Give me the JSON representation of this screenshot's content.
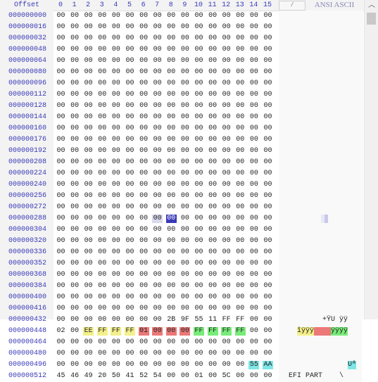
{
  "header": {
    "offset_label": "Offset",
    "columns": [
      "0",
      "1",
      "2",
      "3",
      "4",
      "5",
      "6",
      "7",
      "8",
      "9",
      "10",
      "11",
      "12",
      "13",
      "14",
      "15"
    ],
    "corner_label": "/",
    "ascii_label": "ANSI ASCII"
  },
  "rows": [
    {
      "offset": "000000000",
      "bytes": [
        "00",
        "00",
        "00",
        "00",
        "00",
        "00",
        "00",
        "00",
        "00",
        "00",
        "00",
        "00",
        "00",
        "00",
        "00",
        "00"
      ],
      "ascii": ""
    },
    {
      "offset": "000000016",
      "bytes": [
        "00",
        "00",
        "00",
        "00",
        "00",
        "00",
        "00",
        "00",
        "00",
        "00",
        "00",
        "00",
        "00",
        "00",
        "00",
        "00"
      ],
      "ascii": ""
    },
    {
      "offset": "000000032",
      "bytes": [
        "00",
        "00",
        "00",
        "00",
        "00",
        "00",
        "00",
        "00",
        "00",
        "00",
        "00",
        "00",
        "00",
        "00",
        "00",
        "00"
      ],
      "ascii": ""
    },
    {
      "offset": "000000048",
      "bytes": [
        "00",
        "00",
        "00",
        "00",
        "00",
        "00",
        "00",
        "00",
        "00",
        "00",
        "00",
        "00",
        "00",
        "00",
        "00",
        "00"
      ],
      "ascii": ""
    },
    {
      "offset": "000000064",
      "bytes": [
        "00",
        "00",
        "00",
        "00",
        "00",
        "00",
        "00",
        "00",
        "00",
        "00",
        "00",
        "00",
        "00",
        "00",
        "00",
        "00"
      ],
      "ascii": ""
    },
    {
      "offset": "000000080",
      "bytes": [
        "00",
        "00",
        "00",
        "00",
        "00",
        "00",
        "00",
        "00",
        "00",
        "00",
        "00",
        "00",
        "00",
        "00",
        "00",
        "00"
      ],
      "ascii": ""
    },
    {
      "offset": "000000096",
      "bytes": [
        "00",
        "00",
        "00",
        "00",
        "00",
        "00",
        "00",
        "00",
        "00",
        "00",
        "00",
        "00",
        "00",
        "00",
        "00",
        "00"
      ],
      "ascii": ""
    },
    {
      "offset": "000000112",
      "bytes": [
        "00",
        "00",
        "00",
        "00",
        "00",
        "00",
        "00",
        "00",
        "00",
        "00",
        "00",
        "00",
        "00",
        "00",
        "00",
        "00"
      ],
      "ascii": ""
    },
    {
      "offset": "000000128",
      "bytes": [
        "00",
        "00",
        "00",
        "00",
        "00",
        "00",
        "00",
        "00",
        "00",
        "00",
        "00",
        "00",
        "00",
        "00",
        "00",
        "00"
      ],
      "ascii": ""
    },
    {
      "offset": "000000144",
      "bytes": [
        "00",
        "00",
        "00",
        "00",
        "00",
        "00",
        "00",
        "00",
        "00",
        "00",
        "00",
        "00",
        "00",
        "00",
        "00",
        "00"
      ],
      "ascii": ""
    },
    {
      "offset": "000000160",
      "bytes": [
        "00",
        "00",
        "00",
        "00",
        "00",
        "00",
        "00",
        "00",
        "00",
        "00",
        "00",
        "00",
        "00",
        "00",
        "00",
        "00"
      ],
      "ascii": ""
    },
    {
      "offset": "000000176",
      "bytes": [
        "00",
        "00",
        "00",
        "00",
        "00",
        "00",
        "00",
        "00",
        "00",
        "00",
        "00",
        "00",
        "00",
        "00",
        "00",
        "00"
      ],
      "ascii": ""
    },
    {
      "offset": "000000192",
      "bytes": [
        "00",
        "00",
        "00",
        "00",
        "00",
        "00",
        "00",
        "00",
        "00",
        "00",
        "00",
        "00",
        "00",
        "00",
        "00",
        "00"
      ],
      "ascii": ""
    },
    {
      "offset": "000000208",
      "bytes": [
        "00",
        "00",
        "00",
        "00",
        "00",
        "00",
        "00",
        "00",
        "00",
        "00",
        "00",
        "00",
        "00",
        "00",
        "00",
        "00"
      ],
      "ascii": ""
    },
    {
      "offset": "000000224",
      "bytes": [
        "00",
        "00",
        "00",
        "00",
        "00",
        "00",
        "00",
        "00",
        "00",
        "00",
        "00",
        "00",
        "00",
        "00",
        "00",
        "00"
      ],
      "ascii": ""
    },
    {
      "offset": "000000240",
      "bytes": [
        "00",
        "00",
        "00",
        "00",
        "00",
        "00",
        "00",
        "00",
        "00",
        "00",
        "00",
        "00",
        "00",
        "00",
        "00",
        "00"
      ],
      "ascii": ""
    },
    {
      "offset": "000000256",
      "bytes": [
        "00",
        "00",
        "00",
        "00",
        "00",
        "00",
        "00",
        "00",
        "00",
        "00",
        "00",
        "00",
        "00",
        "00",
        "00",
        "00"
      ],
      "ascii": ""
    },
    {
      "offset": "000000272",
      "bytes": [
        "00",
        "00",
        "00",
        "00",
        "00",
        "00",
        "00",
        "00",
        "00",
        "00",
        "00",
        "00",
        "00",
        "00",
        "00",
        "00"
      ],
      "ascii": ""
    },
    {
      "offset": "000000288",
      "bytes": [
        "00",
        "00",
        "00",
        "00",
        "00",
        "00",
        "00",
        "00",
        "00",
        "00",
        "00",
        "00",
        "00",
        "00",
        "00",
        "00"
      ],
      "ascii": "",
      "marks": {
        "7": "s",
        "8": "caret"
      }
    },
    {
      "offset": "000000304",
      "bytes": [
        "00",
        "00",
        "00",
        "00",
        "00",
        "00",
        "00",
        "00",
        "00",
        "00",
        "00",
        "00",
        "00",
        "00",
        "00",
        "00"
      ],
      "ascii": ""
    },
    {
      "offset": "000000320",
      "bytes": [
        "00",
        "00",
        "00",
        "00",
        "00",
        "00",
        "00",
        "00",
        "00",
        "00",
        "00",
        "00",
        "00",
        "00",
        "00",
        "00"
      ],
      "ascii": ""
    },
    {
      "offset": "000000336",
      "bytes": [
        "00",
        "00",
        "00",
        "00",
        "00",
        "00",
        "00",
        "00",
        "00",
        "00",
        "00",
        "00",
        "00",
        "00",
        "00",
        "00"
      ],
      "ascii": ""
    },
    {
      "offset": "000000352",
      "bytes": [
        "00",
        "00",
        "00",
        "00",
        "00",
        "00",
        "00",
        "00",
        "00",
        "00",
        "00",
        "00",
        "00",
        "00",
        "00",
        "00"
      ],
      "ascii": ""
    },
    {
      "offset": "000000368",
      "bytes": [
        "00",
        "00",
        "00",
        "00",
        "00",
        "00",
        "00",
        "00",
        "00",
        "00",
        "00",
        "00",
        "00",
        "00",
        "00",
        "00"
      ],
      "ascii": ""
    },
    {
      "offset": "000000384",
      "bytes": [
        "00",
        "00",
        "00",
        "00",
        "00",
        "00",
        "00",
        "00",
        "00",
        "00",
        "00",
        "00",
        "00",
        "00",
        "00",
        "00"
      ],
      "ascii": ""
    },
    {
      "offset": "000000400",
      "bytes": [
        "00",
        "00",
        "00",
        "00",
        "00",
        "00",
        "00",
        "00",
        "00",
        "00",
        "00",
        "00",
        "00",
        "00",
        "00",
        "00"
      ],
      "ascii": ""
    },
    {
      "offset": "000000416",
      "bytes": [
        "00",
        "00",
        "00",
        "00",
        "00",
        "00",
        "00",
        "00",
        "00",
        "00",
        "00",
        "00",
        "00",
        "00",
        "00",
        "00"
      ],
      "ascii": ""
    },
    {
      "offset": "000000432",
      "bytes": [
        "00",
        "00",
        "00",
        "00",
        "00",
        "00",
        "00",
        "00",
        "2B",
        "9F",
        "55",
        "11",
        "FF",
        "FF",
        "00",
        "00"
      ],
      "ascii": "        +ŸU ÿÿ  "
    },
    {
      "offset": "000000448",
      "bytes": [
        "02",
        "00",
        "EE",
        "FF",
        "FF",
        "FF",
        "01",
        "00",
        "00",
        "00",
        "FF",
        "FF",
        "FF",
        "FF",
        "00",
        "00"
      ],
      "ascii": "  îÿÿÿ    ÿÿÿÿ  ",
      "marks": {
        "2": "y",
        "3": "y",
        "4": "y",
        "5": "y",
        "6": "r",
        "7": "r",
        "8": "r",
        "9": "r",
        "10": "g",
        "11": "g",
        "12": "g",
        "13": "g"
      }
    },
    {
      "offset": "000000464",
      "bytes": [
        "00",
        "00",
        "00",
        "00",
        "00",
        "00",
        "00",
        "00",
        "00",
        "00",
        "00",
        "00",
        "00",
        "00",
        "00",
        "00"
      ],
      "ascii": ""
    },
    {
      "offset": "000000480",
      "bytes": [
        "00",
        "00",
        "00",
        "00",
        "00",
        "00",
        "00",
        "00",
        "00",
        "00",
        "00",
        "00",
        "00",
        "00",
        "00",
        "00"
      ],
      "ascii": ""
    },
    {
      "offset": "000000496",
      "bytes": [
        "00",
        "00",
        "00",
        "00",
        "00",
        "00",
        "00",
        "00",
        "00",
        "00",
        "00",
        "00",
        "00",
        "00",
        "55",
        "AA"
      ],
      "ascii": "              Uª",
      "marks": {
        "14": "c",
        "15": "c"
      }
    },
    {
      "offset": "000000512",
      "bytes": [
        "45",
        "46",
        "49",
        "20",
        "50",
        "41",
        "52",
        "54",
        "00",
        "00",
        "01",
        "00",
        "5C",
        "00",
        "00",
        "00"
      ],
      "ascii": "EFI PART    \\   "
    }
  ],
  "colors": {
    "offset_text": "#3a3ab8",
    "highlight_yellow": "#f4f08a",
    "highlight_red": "#ec7878",
    "highlight_green": "#78ec78",
    "highlight_cyan": "#7ee6e6",
    "caret": "#3a3ab8"
  },
  "scrollbar": {
    "up_icon": "chevron-up-icon"
  }
}
